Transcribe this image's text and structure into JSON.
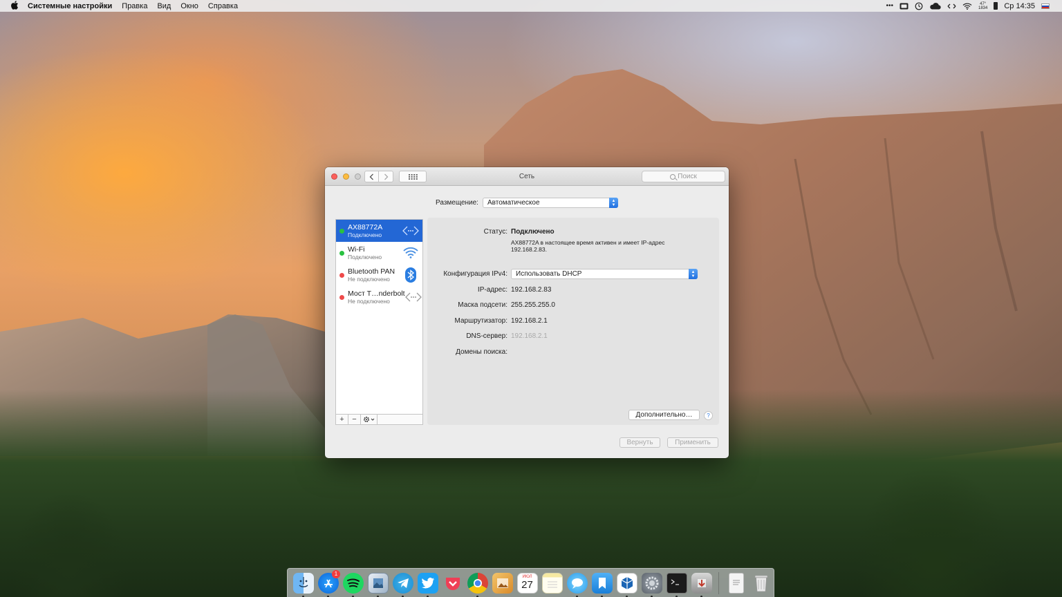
{
  "menubar": {
    "app_name": "Системные настройки",
    "items": [
      "Правка",
      "Вид",
      "Окно",
      "Справка"
    ],
    "temperature_top": "47°",
    "temperature_bottom": "1834",
    "clock": "Ср 14:35",
    "status_icons": [
      "more-icon",
      "keyboard-icon",
      "time-machine-icon",
      "cloud-icon",
      "network-arrows-icon",
      "wifi-icon",
      "temperature-widget",
      "battery-icon",
      "clock",
      "flag-icon"
    ]
  },
  "window": {
    "title": "Сеть",
    "search_placeholder": "Поиск",
    "location_label": "Размещение:",
    "location_value": "Автоматическое",
    "services": [
      {
        "name": "AX88772A",
        "status": "Подключено",
        "state": "connected",
        "icon": "ethernet-icon",
        "selected": true
      },
      {
        "name": "Wi-Fi",
        "status": "Подключено",
        "state": "connected",
        "icon": "wifi-icon",
        "selected": false
      },
      {
        "name": "Bluetooth PAN",
        "status": "Не подключено",
        "state": "disconnected",
        "icon": "bluetooth-icon",
        "selected": false
      },
      {
        "name": "Мост T…nderbolt",
        "status": "Не подключено",
        "state": "disconnected",
        "icon": "thunderbolt-bridge-icon",
        "selected": false
      }
    ],
    "detail": {
      "status_label": "Статус:",
      "status_value": "Подключено",
      "status_description": "AX88772A в настоящее время активен и имеет IP-адрес 192.168.2.83.",
      "ipv4_config_label": "Конфигурация IPv4:",
      "ipv4_config_value": "Использовать DHCP",
      "ip_label": "IP-адрес:",
      "ip_value": "192.168.2.83",
      "subnet_label": "Маска подсети:",
      "subnet_value": "255.255.255.0",
      "router_label": "Маршрутизатор:",
      "router_value": "192.168.2.1",
      "dns_label": "DNS-сервер:",
      "dns_value": "192.168.2.1",
      "search_domains_label": "Домены поиска:",
      "advanced_button": "Дополнительно…",
      "help_button": "?"
    },
    "revert_button": "Вернуть",
    "apply_button": "Применить"
  },
  "dock": {
    "apps": [
      {
        "name": "finder",
        "running": true
      },
      {
        "name": "app-store",
        "running": true,
        "badge": "1"
      },
      {
        "name": "spotify",
        "running": true
      },
      {
        "name": "preview",
        "running": true
      },
      {
        "name": "telegram",
        "running": true
      },
      {
        "name": "twitter",
        "running": true
      },
      {
        "name": "pocket",
        "running": false
      },
      {
        "name": "chrome",
        "running": true
      },
      {
        "name": "photo-slideshow",
        "running": false
      },
      {
        "name": "calendar",
        "running": false,
        "day": "27",
        "month": "ИЮЛ"
      },
      {
        "name": "notes",
        "running": false
      },
      {
        "name": "messages",
        "running": true
      },
      {
        "name": "bookmarks",
        "running": true
      },
      {
        "name": "sketchup",
        "running": true
      },
      {
        "name": "system-preferences",
        "running": true
      },
      {
        "name": "terminal",
        "running": true
      },
      {
        "name": "migration-assistant",
        "running": true
      }
    ],
    "right": [
      {
        "name": "documents-stack"
      },
      {
        "name": "trash"
      }
    ]
  }
}
